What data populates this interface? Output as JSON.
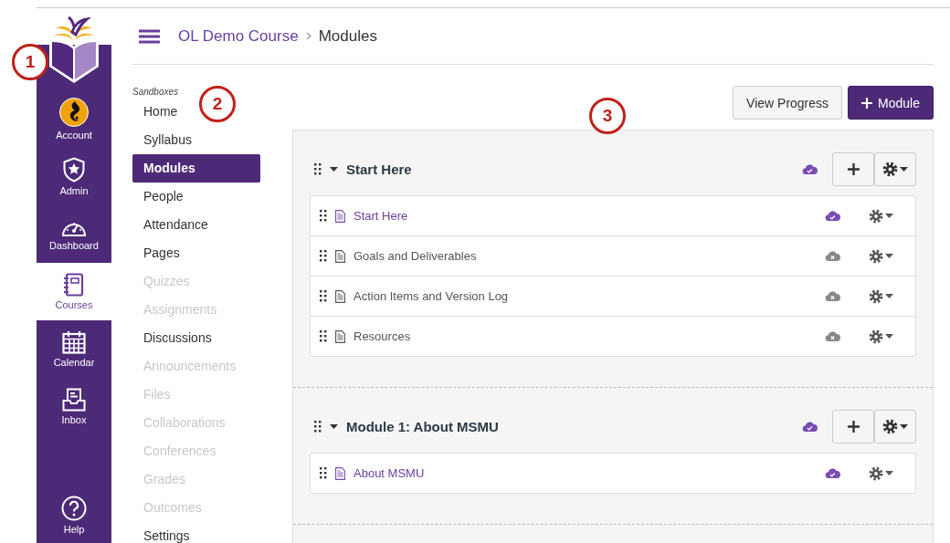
{
  "global_nav": {
    "items": [
      {
        "kind": "account",
        "label": "Account",
        "selected": false
      },
      {
        "kind": "admin",
        "label": "Admin",
        "selected": false
      },
      {
        "kind": "dashboard",
        "label": "Dashboard",
        "selected": false
      },
      {
        "kind": "courses",
        "label": "Courses",
        "selected": true
      },
      {
        "kind": "calendar",
        "label": "Calendar",
        "selected": false
      },
      {
        "kind": "inbox",
        "label": "Inbox",
        "selected": false
      },
      {
        "kind": "help",
        "label": "Help",
        "selected": false
      }
    ]
  },
  "breadcrumb": [
    "OL Demo Course",
    "Modules"
  ],
  "course_nav": {
    "heading": "Sandboxes",
    "items": [
      {
        "label": "Home",
        "selected": false,
        "disabled": false
      },
      {
        "label": "Syllabus",
        "selected": false,
        "disabled": false
      },
      {
        "label": "Modules",
        "selected": true,
        "disabled": false
      },
      {
        "label": "People",
        "selected": false,
        "disabled": false
      },
      {
        "label": "Attendance",
        "selected": false,
        "disabled": false
      },
      {
        "label": "Pages",
        "selected": false,
        "disabled": false
      },
      {
        "label": "Quizzes",
        "selected": false,
        "disabled": true
      },
      {
        "label": "Assignments",
        "selected": false,
        "disabled": true
      },
      {
        "label": "Discussions",
        "selected": false,
        "disabled": false
      },
      {
        "label": "Announcements",
        "selected": false,
        "disabled": true
      },
      {
        "label": "Files",
        "selected": false,
        "disabled": true
      },
      {
        "label": "Collaborations",
        "selected": false,
        "disabled": true
      },
      {
        "label": "Conferences",
        "selected": false,
        "disabled": true
      },
      {
        "label": "Grades",
        "selected": false,
        "disabled": true
      },
      {
        "label": "Outcomes",
        "selected": false,
        "disabled": true
      },
      {
        "label": "Settings",
        "selected": false,
        "disabled": false
      }
    ]
  },
  "toolbar": {
    "buttons": [
      {
        "kind": "secondary",
        "label": "View Progress"
      },
      {
        "kind": "add",
        "label": "Module"
      }
    ]
  },
  "modules": [
    {
      "title": "Start Here",
      "published": true,
      "expanded": true,
      "items": [
        {
          "title": "Start Here",
          "published": true
        },
        {
          "title": "Goals and Deliverables",
          "published": false
        },
        {
          "title": "Action Items and Version Log",
          "published": false
        },
        {
          "title": "Resources",
          "published": false
        }
      ]
    },
    {
      "title": "Module 1: About MSMU",
      "published": true,
      "expanded": true,
      "items": [
        {
          "title": "About MSMU",
          "published": true
        }
      ]
    }
  ],
  "callouts": [
    "1",
    "2",
    "3"
  ]
}
